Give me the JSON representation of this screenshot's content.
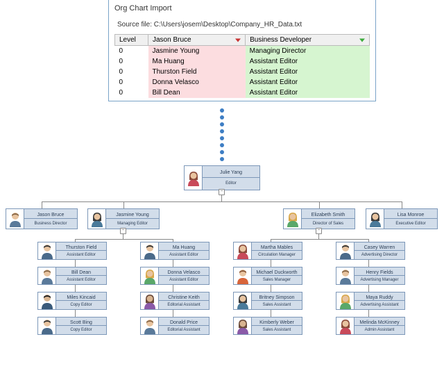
{
  "dialog": {
    "title": "Org Chart Import",
    "source_label": "Source file: C:\\Users\\josem\\Desktop\\Company_HR_Data.txt",
    "headers": {
      "level": "Level",
      "name": "Jason Bruce",
      "role": "Business Developer"
    },
    "rows": [
      {
        "level": "0",
        "name": "Jasmine Young",
        "role": "Managing Director"
      },
      {
        "level": "0",
        "name": "Ma Huang",
        "role": "Assistant Editor"
      },
      {
        "level": "0",
        "name": "Thurston Field",
        "role": "Assistant Editor"
      },
      {
        "level": "0",
        "name": "Donna Velasco",
        "role": "Assistant Editor"
      },
      {
        "level": "0",
        "name": "Bill Dean",
        "role": "Assistant Editor"
      }
    ]
  },
  "chart": {
    "top": {
      "name": "Julie Yang",
      "role": "Editor"
    },
    "lvl2": [
      {
        "name": "Jason Bruce",
        "role": "Business Director"
      },
      {
        "name": "Jasmine Young",
        "role": "Managing Editor"
      },
      {
        "name": "Elizabeth Smith",
        "role": "Director of Sales"
      },
      {
        "name": "Lisa Monroe",
        "role": "Executive Editor"
      }
    ],
    "col1": [
      {
        "name": "Thurston Field",
        "role": "Assistant Editor"
      },
      {
        "name": "Bill Dean",
        "role": "Assistant Editor"
      },
      {
        "name": "Miles Kincaid",
        "role": "Copy Editor"
      },
      {
        "name": "Scott Bing",
        "role": "Copy Editor"
      }
    ],
    "col2": [
      {
        "name": "Ma Huang",
        "role": "Assistant Editor"
      },
      {
        "name": "Donna Velasco",
        "role": "Assistant Editor"
      },
      {
        "name": "Christine Keith",
        "role": "Editorial Assistant"
      },
      {
        "name": "Donald Price",
        "role": "Editorial Assistant"
      }
    ],
    "col3": [
      {
        "name": "Martha Mables",
        "role": "Circulation Manager"
      },
      {
        "name": "Michael Duckworth",
        "role": "Sales Manager"
      },
      {
        "name": "Britney Simpson",
        "role": "Sales Assistant"
      },
      {
        "name": "Kimberly Weber",
        "role": "Sales Assistant"
      }
    ],
    "col4": [
      {
        "name": "Casey Warren",
        "role": "Advertising Director"
      },
      {
        "name": "Henry Fields",
        "role": "Advertising Manager"
      },
      {
        "name": "Maya Ruddy",
        "role": "Advertising Assistant"
      },
      {
        "name": "Melinda McKinney",
        "role": "Admin Assistant"
      }
    ]
  }
}
